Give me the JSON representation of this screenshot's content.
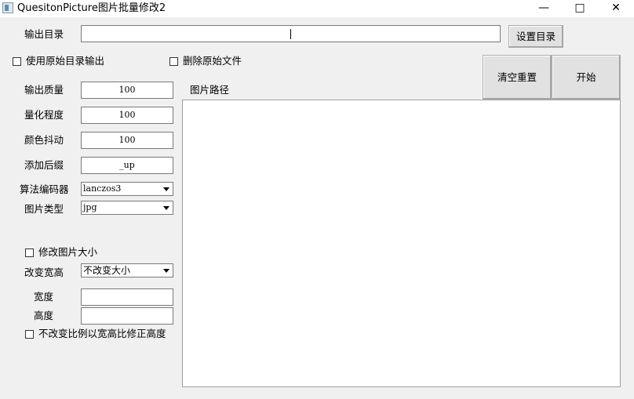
{
  "window": {
    "title": "QuesitonPicture图片批量修改2",
    "minimize_glyph": "—",
    "maximize_glyph": "□",
    "close_glyph": "✕"
  },
  "output_dir": {
    "label": "输出目录",
    "value": "",
    "set_button": "设置目录"
  },
  "options": {
    "use_original_dir": {
      "label": "使用原始目录输出",
      "checked": false
    },
    "delete_original": {
      "label": "删除原始文件",
      "checked": false
    }
  },
  "actions": {
    "reset_button": "清空重置",
    "start_button": "开始"
  },
  "settings": {
    "quality": {
      "label": "输出质量",
      "value": "100"
    },
    "quantize": {
      "label": "量化程度",
      "value": "100"
    },
    "dither": {
      "label": "颜色抖动",
      "value": "100"
    },
    "suffix": {
      "label": "添加后缀",
      "value": "_up"
    },
    "codec": {
      "label": "算法编码器",
      "value": "lanczos3"
    },
    "image_type": {
      "label": "图片类型",
      "value": "jpg"
    }
  },
  "resize": {
    "enable": {
      "label": "修改图片大小",
      "checked": false
    },
    "mode": {
      "label": "改变宽高",
      "value": "不改变大小"
    },
    "width": {
      "label": "宽度",
      "value": ""
    },
    "height": {
      "label": "高度",
      "value": ""
    },
    "keep_ratio": {
      "label": "不改变比例以宽高比修正高度",
      "checked": false
    }
  },
  "image_list": {
    "label": "图片路径",
    "items": []
  }
}
